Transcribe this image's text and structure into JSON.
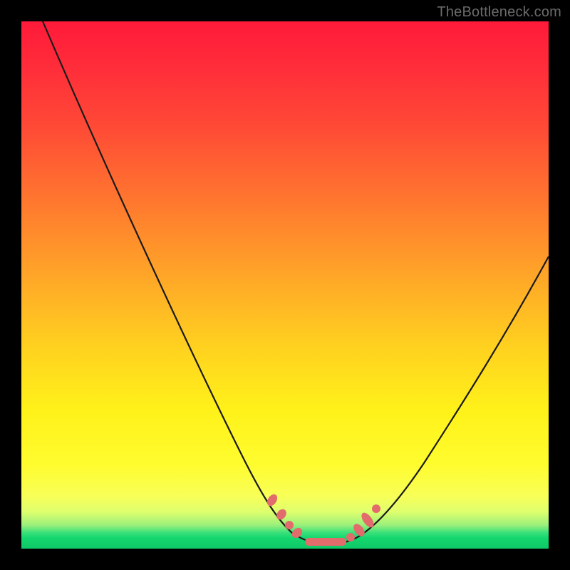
{
  "watermark": "TheBottleneck.com",
  "colors": {
    "page_bg": "#000000",
    "curve_stroke": "#1a1a1a",
    "marker_fill": "#e26b6b",
    "marker_stroke": "#d85f5f"
  },
  "chart_data": {
    "type": "line",
    "title": "",
    "xlabel": "",
    "ylabel": "",
    "xlim": [
      0,
      100
    ],
    "ylim": [
      0,
      100
    ],
    "grid": false,
    "series": [
      {
        "name": "left-branch",
        "x": [
          4,
          10,
          18,
          26,
          34,
          40,
          44,
          47,
          48.5,
          50,
          52,
          54,
          56,
          58
        ],
        "y": [
          100,
          83,
          66,
          49,
          32,
          20,
          12,
          7,
          5,
          3.5,
          2.5,
          2,
          2,
          2
        ]
      },
      {
        "name": "right-branch",
        "x": [
          58,
          60,
          62,
          64,
          66,
          70,
          76,
          84,
          92,
          100
        ],
        "y": [
          2,
          2.5,
          3.5,
          5,
          7.5,
          13,
          22,
          35,
          47,
          58
        ]
      },
      {
        "name": "markers",
        "kind": "scatter",
        "x": [
          47,
          48.5,
          50,
          51,
          53,
          55,
          57,
          59,
          61,
          62.5,
          64,
          65
        ],
        "y": [
          7.2,
          5.2,
          3.8,
          3.2,
          2.4,
          2.1,
          2.0,
          2.2,
          3.0,
          4.2,
          6.0,
          8.2
        ]
      }
    ],
    "background_gradient": {
      "top": "#ff1a3a",
      "mid": "#fff21a",
      "bottom": "#0fc966"
    }
  }
}
